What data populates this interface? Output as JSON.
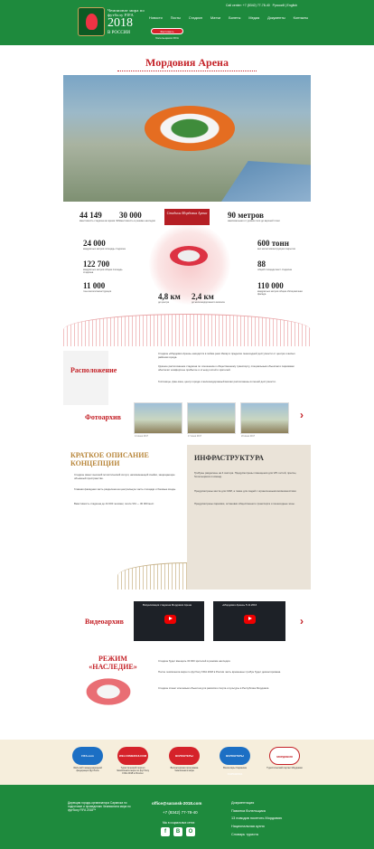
{
  "header": {
    "logo_small": "Чемпионат мира по футболу FIFA",
    "logo_year": "2018",
    "logo_country": "В РОССИИ",
    "phone_label": "Call center: +7 (8342) 77-78-40",
    "lang": "Русский | English",
    "nav": [
      "Новости",
      "Посты",
      "Стадион",
      "Матчи",
      "Билеты",
      "Медиа",
      "Документы",
      "Контакты"
    ],
    "cta": "Фестиваль болельщиков FIFA"
  },
  "page_title": "Мордовия Арена",
  "infographic": {
    "badge": "Стадион Мордовия Арена",
    "stats": [
      {
        "n": "44 149",
        "d": "вместимость стадиона во время ЧМ"
      },
      {
        "n": "30 000",
        "d": "вместимость в режиме наследия"
      },
      {
        "n": "90 метров",
        "d": "максимальная от уровня поля до верхней точки"
      },
      {
        "n": "24 000",
        "d": "квадратных метров площадь стадиона"
      },
      {
        "n": "600 тонн",
        "d": "вес металлоконструкции покрытия"
      },
      {
        "n": "122 700",
        "d": "квадратных метров общая площадь стадиона"
      },
      {
        "n": "88",
        "d": "общей площади мест стадиона"
      },
      {
        "n": "11 000",
        "d": "тонн металлоконструкции"
      },
      {
        "n": "110 000",
        "d": "квадратных метров общая облицовочная фасада"
      },
      {
        "n": "4,8 км",
        "d": "до центра"
      },
      {
        "n": "2,4 км",
        "d": "до железнодорожного вокзала"
      }
    ]
  },
  "location": {
    "title": "Расположение",
    "p1": "Стадион «Мордовия Арена» находится в пойме реки Инсар в пределах пешеходной доступности от центра и жилых районов города.",
    "p2": "Удачное расположение стадиона по отношению к общественному транспорту, специальным объектам и парковкам обеспечит комфортное прибытие и отъезд гостей и зрителей.",
    "p3": "Гостиницы, фан-зона, центр города и железнодорожный вокзал расположены в пешей доступности."
  },
  "photos": {
    "title": "Фотоархив",
    "captions": [
      "14 июня 2017",
      "17 июня 2017",
      "20 июня 2017",
      "25 июня 2017"
    ]
  },
  "concept": {
    "title": "Краткое описание концепции",
    "p1": "Стадион имеет высокий эллиптический силуэт, напоминающий ячейки, защищающие объемный пространство.",
    "p2": "Главная фасадная часть разделена на центральную часть площади и боковые входы.",
    "p3": "Вместимость стадиона до 44 000 человек; после ЧМ — 30 000 мест."
  },
  "infra": {
    "title": "Инфраструктура",
    "p1": "Трибуны разделены на 4 сектора. Предусмотрены помещения для VIP-гостей, прессы, болельщиков и команд.",
    "p2": "Предусмотрены места для СМИ, а также для людей с ограниченными возможностями.",
    "p3": "Предусмотрены парковки, остановки общественного транспорта и пешеходные зоны."
  },
  "videos": {
    "title": "Видеоархив",
    "items": [
      "Визуализация стадиона Мордовия Арена",
      "«Мордовия Арена» 5.11.2016"
    ]
  },
  "legacy": {
    "title": "Режим «наследие»",
    "p1": "Стадион будет вмещать 30 000 зрителей в режиме наследия.",
    "p2": "После чемпионата мира по футболу FIFA 2018 в России часть временных трибун будет демонтирована.",
    "p3": "Стадион станет ключевым объектом для развития спорта и культуры в Республике Мордовия."
  },
  "partners": [
    {
      "logo": "FIFA.com",
      "cap": "Web-сайт международной федерации футбола",
      "color": "#1c6fc4"
    },
    {
      "logo": "WELCOME2018.COM",
      "cap": "Туристический портал Чемпионата мира по футболу FIFA 2018 в России",
      "color": "#d5222a"
    },
    {
      "logo": "ВОЛОНТЕРЫ",
      "cap": "Волонтерская программа Чемпионата мира",
      "color": "#d5222a"
    },
    {
      "logo": "ВОЛОНТЕРЫ САРАНСКА",
      "cap": "Волонтеры Саранска",
      "color": "#1c6fc4"
    },
    {
      "logo": "МОРДОВИЯ",
      "cap": "Туристический портал Мордовии",
      "color": "#c42127"
    }
  ],
  "footer": {
    "org": "Дирекция города-организатора Саранска по подготовке и проведению Чемпионата мира по футболу FIFA 2018™",
    "email": "office@saransk-2018.com",
    "phone": "+7 (8342) 77-78-40",
    "social_label": "Мы в социальных сетях",
    "social": [
      "f",
      "B",
      "O"
    ],
    "links": [
      "Документация",
      "Памятка болельщика",
      "13 поводов посетить Мордовию",
      "Национальная кухня",
      "Словарь туриста"
    ]
  }
}
